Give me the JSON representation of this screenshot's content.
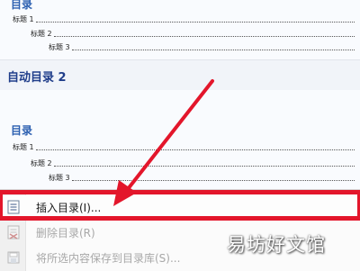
{
  "gallery": {
    "top_preview": {
      "title": "目录",
      "entries": [
        {
          "label": "标题 1",
          "level": 1
        },
        {
          "label": "标题 2",
          "level": 2
        },
        {
          "label": "标题 3",
          "level": 3
        }
      ]
    },
    "auto_toc_2": {
      "header": "自动目录 2",
      "title": "目录",
      "entries": [
        {
          "label": "标题 1",
          "level": 1
        },
        {
          "label": "标题 2",
          "level": 2
        },
        {
          "label": "标题 3",
          "level": 3
        }
      ]
    }
  },
  "menu": {
    "items": [
      {
        "label": "插入目录(I)...",
        "enabled": true,
        "icon": "document-toc-icon"
      },
      {
        "label": "删除目录(R)",
        "enabled": false,
        "icon": "delete-toc-icon"
      },
      {
        "label": "将所选内容保存到目录库(S)...",
        "enabled": false,
        "icon": "save-selection-icon"
      }
    ]
  },
  "annotation": {
    "color": "#e3162b"
  },
  "watermark": "易坊好文馆"
}
